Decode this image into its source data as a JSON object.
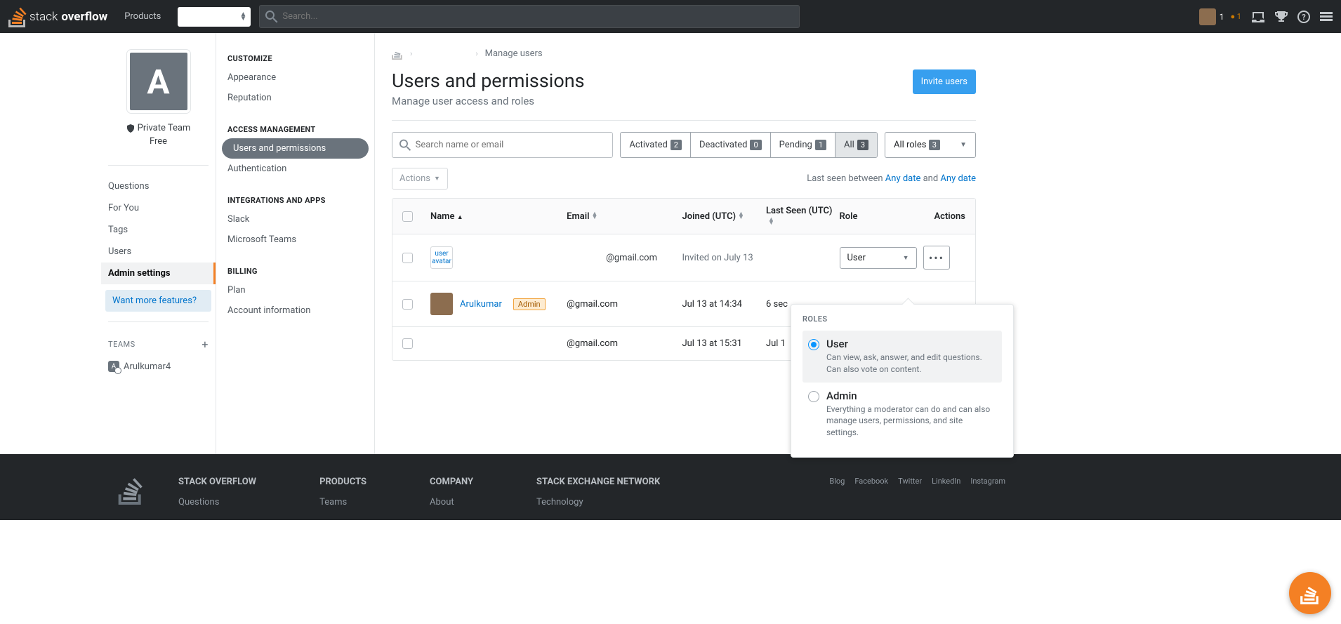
{
  "topbar": {
    "brand": "stack overflow",
    "products": "Products",
    "search_placeholder": "Search...",
    "rep": "1",
    "bronze": "● 1"
  },
  "left_sidebar": {
    "team_letter": "A",
    "team_label": "Private Team",
    "team_plan": "Free",
    "nav": [
      "Questions",
      "For You",
      "Tags",
      "Users",
      "Admin settings"
    ],
    "want_more": "Want more features?",
    "teams_title": "TEAMS",
    "team_name": "Arulkumar4"
  },
  "settings_nav": {
    "groups": [
      {
        "title": "CUSTOMIZE",
        "items": [
          "Appearance",
          "Reputation"
        ]
      },
      {
        "title": "ACCESS MANAGEMENT",
        "items": [
          "Users and permissions",
          "Authentication"
        ]
      },
      {
        "title": "INTEGRATIONS AND APPS",
        "items": [
          "Slack",
          "Microsoft Teams"
        ]
      },
      {
        "title": "BILLING",
        "items": [
          "Plan",
          "Account information"
        ]
      }
    ],
    "active": "Users and permissions"
  },
  "breadcrumb": {
    "page": "Manage users"
  },
  "page": {
    "title": "Users and permissions",
    "subtitle": "Manage user access and roles",
    "invite": "Invite users"
  },
  "filters": {
    "search_placeholder": "Search name or email",
    "tabs": [
      {
        "label": "Activated",
        "count": "2"
      },
      {
        "label": "Deactivated",
        "count": "0"
      },
      {
        "label": "Pending",
        "count": "1"
      },
      {
        "label": "All",
        "count": "3",
        "active": true
      }
    ],
    "roles_label": "All roles",
    "roles_count": "3"
  },
  "actions": {
    "button": "Actions",
    "last_seen_prefix": "Last seen between ",
    "any_date": "Any date",
    "and": " and "
  },
  "table": {
    "headers": {
      "name": "Name",
      "email": "Email",
      "joined": "Joined (UTC)",
      "lastseen": "Last Seen (UTC)",
      "role": "Role",
      "actions": "Actions"
    },
    "rows": [
      {
        "name_placeholder_top": "user",
        "name_placeholder_bottom": "avatar",
        "email": "@gmail.com",
        "joined": "Invited on July 13",
        "lastseen": "",
        "role": "User",
        "has_role_select": true
      },
      {
        "name": "Arulkumar",
        "badge": "Admin",
        "email": "@gmail.com",
        "joined": "Jul 13 at 14:34",
        "lastseen": "6 sec"
      },
      {
        "name": "",
        "email": "@gmail.com",
        "joined": "Jul 13 at 15:31",
        "lastseen": "Jul 1"
      }
    ]
  },
  "role_popup": {
    "title": "ROLES",
    "options": [
      {
        "name": "User",
        "desc": "Can view, ask, answer, and edit questions. Can also vote on content.",
        "selected": true
      },
      {
        "name": "Admin",
        "desc": "Everything a moderator can do and can also manage users, permissions, and site settings."
      }
    ]
  },
  "footer": {
    "cols": [
      {
        "title": "STACK OVERFLOW",
        "links": [
          "Questions"
        ]
      },
      {
        "title": "PRODUCTS",
        "links": [
          "Teams"
        ]
      },
      {
        "title": "COMPANY",
        "links": [
          "About"
        ]
      },
      {
        "title": "STACK EXCHANGE NETWORK",
        "links": [
          "Technology"
        ]
      }
    ],
    "social": [
      "Blog",
      "Facebook",
      "Twitter",
      "LinkedIn",
      "Instagram"
    ]
  }
}
